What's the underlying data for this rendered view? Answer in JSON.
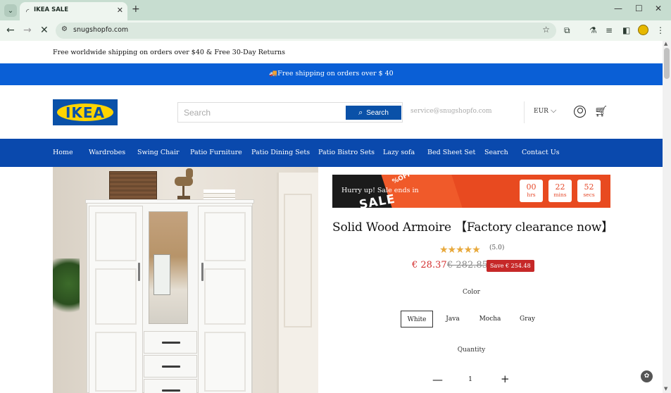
{
  "browser": {
    "tab_title": "IKEA SALE",
    "url": "snugshopfo.com"
  },
  "announcement": "Free worldwide shipping on orders over $40 & Free 30-Day Returns",
  "promo_bar": "🚚Free shipping on orders over $ 40",
  "header": {
    "logo_text": "IKEA",
    "search_placeholder": "Search",
    "search_button": "Search",
    "service_email": "service@snugshopfo.com",
    "currency": "EUR"
  },
  "menu": [
    "Home",
    "Wardrobes",
    "Swing Chair",
    "Patio Furniture",
    "Patio Dining Sets",
    "Patio Bistro Sets",
    "Lazy sofa",
    "Bed Sheet Set",
    "Search",
    "Contact Us"
  ],
  "countdown": {
    "banner_word": "SALE",
    "banner_circle": "%OFF",
    "text": "Hurry up! Sale ends in",
    "hours": "00",
    "hours_label": "hrs",
    "mins": "22",
    "mins_label": "mins",
    "secs": "52",
    "secs_label": "secs"
  },
  "product": {
    "title": "Solid Wood Armoire 【Factory clearance now】",
    "stars": "★★★★★",
    "rating": "(5.0)",
    "price": "€ 28.37",
    "compare_price": "€ 282.85",
    "save": "Save € 254.48",
    "color_label": "Color",
    "colors": [
      "White",
      "Java",
      "Mocha",
      "Gray"
    ],
    "selected_color": "White",
    "quantity_label": "Quantity",
    "quantity": "1"
  },
  "colors": {
    "promo_blue": "#0a5fd6",
    "menu_blue": "#0a49ad",
    "price_red": "#d32f2f",
    "save_red": "#c62828",
    "star_gold": "#e8a93c"
  }
}
